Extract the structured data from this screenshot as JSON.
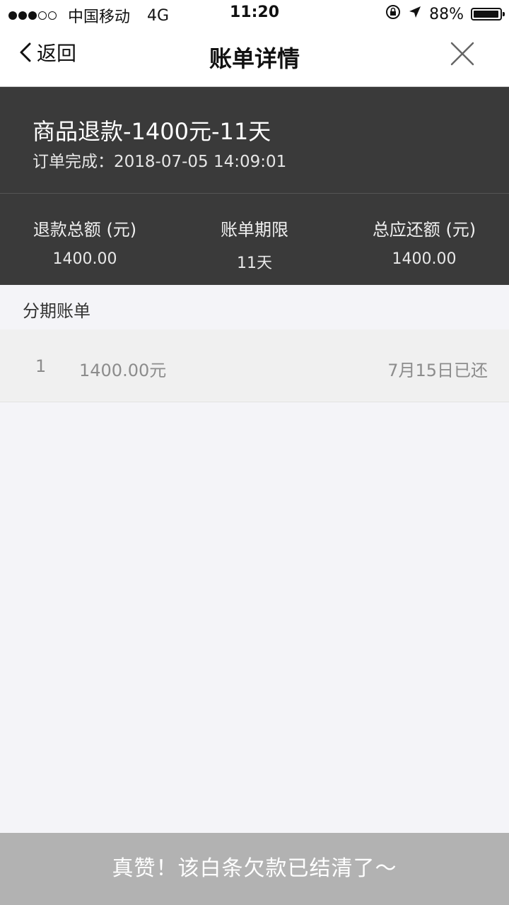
{
  "status_bar": {
    "carrier": "中国移动",
    "network": "4G",
    "time": "11:20",
    "battery": "88%"
  },
  "nav": {
    "back_label": "返回",
    "title": "账单详情"
  },
  "summary": {
    "title": "商品退款-1400元-11天",
    "subtitle": "订单完成：2018-07-05 14:09:01",
    "stats": [
      {
        "label": "退款总额 (元)",
        "value": "1400.00"
      },
      {
        "label": "账单期限",
        "value": "11天"
      },
      {
        "label": "总应还额 (元)",
        "value": "1400.00"
      }
    ]
  },
  "installments": {
    "section_label": "分期账单",
    "rows": [
      {
        "index": "1",
        "amount": "1400.00元",
        "status": "7月15日已还"
      }
    ]
  },
  "footer": {
    "message": "真赞！该白条欠款已结清了～"
  }
}
